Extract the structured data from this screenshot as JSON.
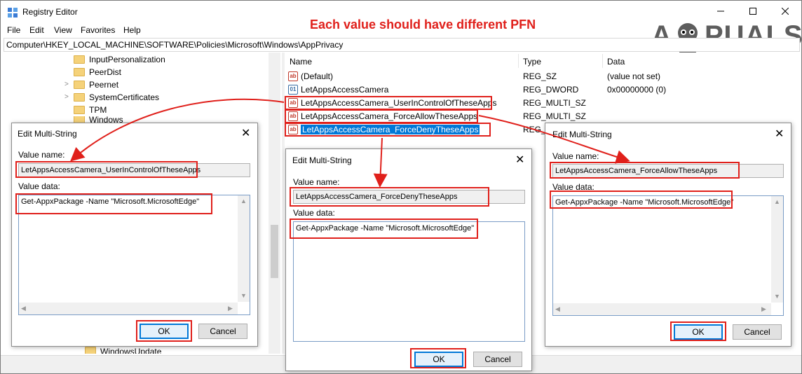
{
  "window": {
    "title": "Registry Editor",
    "heading": "Each value should have different PFN",
    "logo": "APPUALS"
  },
  "menu": [
    "File",
    "Edit",
    "View",
    "Favorites",
    "Help"
  ],
  "address": "Computer\\HKEY_LOCAL_MACHINE\\SOFTWARE\\Policies\\Microsoft\\Windows\\AppPrivacy",
  "tree": [
    {
      "label": "InputPersonalization"
    },
    {
      "label": "PeerDist"
    },
    {
      "label": "Peernet"
    },
    {
      "label": "SystemCertificates"
    },
    {
      "label": "TPM"
    },
    {
      "label": "Windows"
    },
    {
      "label": "WindowsUpdate"
    }
  ],
  "columns": {
    "name": "Name",
    "type": "Type",
    "data": "Data"
  },
  "values": [
    {
      "name": "(Default)",
      "type": "REG_SZ",
      "data": "(value not set)",
      "icon": "ab"
    },
    {
      "name": "LetAppsAccessCamera",
      "type": "REG_DWORD",
      "data": "0x00000000 (0)",
      "icon": "bin"
    },
    {
      "name": "LetAppsAccessCamera_UserInControlOfTheseApps",
      "type": "REG_MULTI_SZ",
      "data": "",
      "icon": "ab"
    },
    {
      "name": "LetAppsAccessCamera_ForceAllowTheseApps",
      "type": "REG_MULTI_SZ",
      "data": "",
      "icon": "ab"
    },
    {
      "name": "LetAppsAccessCamera_ForceDenyTheseApps",
      "type": "REG_M",
      "data": "",
      "icon": "ab"
    }
  ],
  "dialogs": [
    {
      "title": "Edit Multi-String",
      "value_name_label": "Value name:",
      "value_name": "LetAppsAccessCamera_UserInControlOfTheseApps",
      "value_data_label": "Value data:",
      "value_data": "Get-AppxPackage -Name \"Microsoft.MicrosoftEdge\"",
      "ok": "OK",
      "cancel": "Cancel"
    },
    {
      "title": "Edit Multi-String",
      "value_name_label": "Value name:",
      "value_name": "LetAppsAccessCamera_ForceDenyTheseApps",
      "value_data_label": "Value data:",
      "value_data": "Get-AppxPackage -Name \"Microsoft.MicrosoftEdge\"",
      "ok": "OK",
      "cancel": "Cancel"
    },
    {
      "title": "Edit Multi-String",
      "value_name_label": "Value name:",
      "value_name": "LetAppsAccessCamera_ForceAllowTheseApps",
      "value_data_label": "Value data:",
      "value_data": "Get-AppxPackage -Name \"Microsoft.MicrosoftEdge\"",
      "ok": "OK",
      "cancel": "Cancel"
    }
  ],
  "colors": {
    "accent": "#0078d7",
    "annotation": "#e0201b",
    "folder": "#f5d27a"
  }
}
